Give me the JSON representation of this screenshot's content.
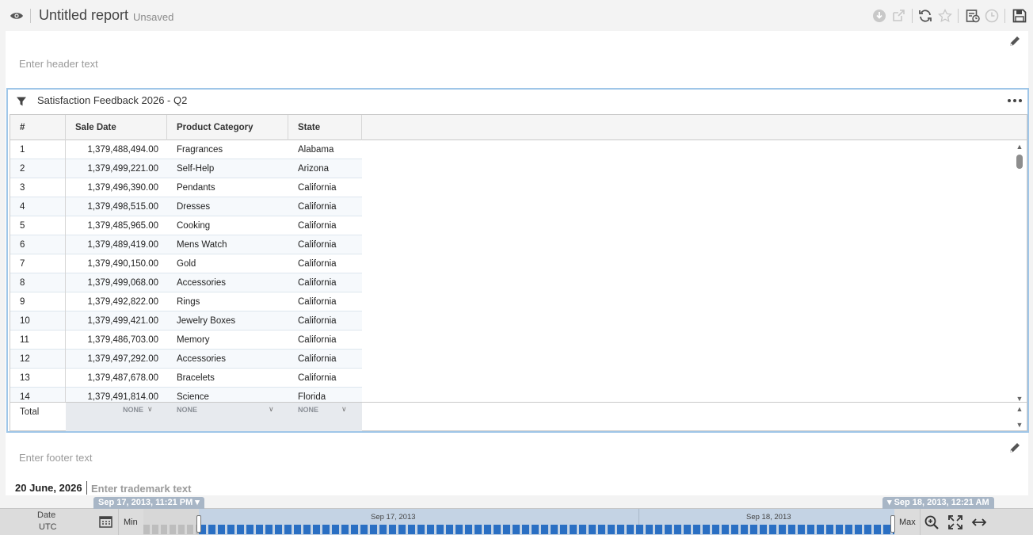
{
  "header": {
    "title": "Untitled report",
    "status": "Unsaved"
  },
  "page": {
    "header_placeholder": "Enter header text",
    "footer_placeholder": "Enter footer text",
    "date_stamp": "20 June, 2026",
    "trademark_placeholder": "Enter trademark text"
  },
  "widget": {
    "title": "Satisfaction Feedback 2026 - Q2",
    "columns": [
      "#",
      "Sale Date",
      "Product Category",
      "State"
    ],
    "rows": [
      [
        "1",
        "1,379,488,494.00",
        "Fragrances",
        "Alabama"
      ],
      [
        "2",
        "1,379,499,221.00",
        "Self-Help",
        "Arizona"
      ],
      [
        "3",
        "1,379,496,390.00",
        "Pendants",
        "California"
      ],
      [
        "4",
        "1,379,498,515.00",
        "Dresses",
        "California"
      ],
      [
        "5",
        "1,379,485,965.00",
        "Cooking",
        "California"
      ],
      [
        "6",
        "1,379,489,419.00",
        "Mens Watch",
        "California"
      ],
      [
        "7",
        "1,379,490,150.00",
        "Gold",
        "California"
      ],
      [
        "8",
        "1,379,499,068.00",
        "Accessories",
        "California"
      ],
      [
        "9",
        "1,379,492,822.00",
        "Rings",
        "California"
      ],
      [
        "10",
        "1,379,499,421.00",
        "Jewelry Boxes",
        "California"
      ],
      [
        "11",
        "1,379,486,703.00",
        "Memory",
        "California"
      ],
      [
        "12",
        "1,379,497,292.00",
        "Accessories",
        "California"
      ],
      [
        "13",
        "1,379,487,678.00",
        "Bracelets",
        "California"
      ],
      [
        "14",
        "1,379,491,814.00",
        "Science",
        "Florida"
      ]
    ],
    "total_label": "Total",
    "aggregations": [
      "NONE",
      "NONE",
      "NONE"
    ]
  },
  "timeline": {
    "field_label": "Date",
    "timezone": "UTC",
    "min_label": "Min",
    "max_label": "Max",
    "range_start": "Sep 17, 2013, 11:21 PM",
    "range_end": "Sep 18, 2013, 12:21 AM",
    "axis_labels": [
      "Sep 17, 2013",
      "Sep 18, 2013"
    ]
  },
  "icons": {
    "accent": "#2a6fc3",
    "selection_border": "#9fc6e8"
  }
}
